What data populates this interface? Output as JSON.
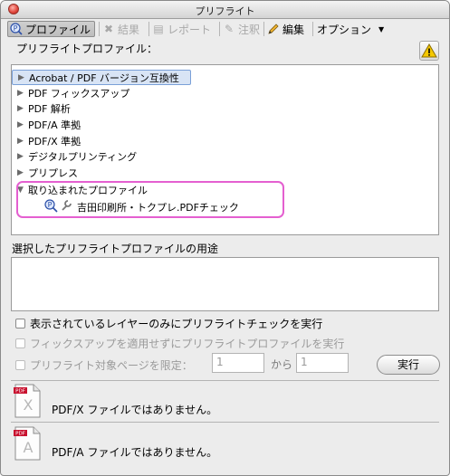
{
  "window": {
    "title": "プリフライト"
  },
  "toolbar": {
    "profile": "プロファイル",
    "results": "結果",
    "report": "レポート",
    "notes": "注釈",
    "edit": "編集",
    "options": "オプション"
  },
  "profiles_label": "プリフライトプロファイル：",
  "profiles": [
    {
      "label": "Acrobat / PDF バージョン互換性",
      "selected": true
    },
    {
      "label": "PDF フィックスアップ"
    },
    {
      "label": "PDF 解析"
    },
    {
      "label": "PDF/A 準拠"
    },
    {
      "label": "PDF/X 準拠"
    },
    {
      "label": "デジタルプリンティング"
    },
    {
      "label": "プリプレス"
    },
    {
      "label": "取り込まれたプロファイル",
      "expanded": true
    },
    {
      "label": "吉田印刷所・トクプレ.PDFチェック",
      "child": true
    }
  ],
  "usage_label": "選択したプリフライトプロファイルの用途",
  "options": {
    "visible_layers": "表示されているレイヤーのみにプリフライトチェックを実行",
    "no_fixups": "フィックスアップを適用せずにプリフライトプロファイルを実行",
    "limit_pages": "プリフライト対象ページを限定：",
    "from_page": "1",
    "kara": "から",
    "to_page": "1"
  },
  "run_button": "実行",
  "status": {
    "pdfx": "PDF/X ファイルではありません。",
    "pdfa": "PDF/A ファイルではありません。"
  },
  "doc_icon_label": "PDF"
}
